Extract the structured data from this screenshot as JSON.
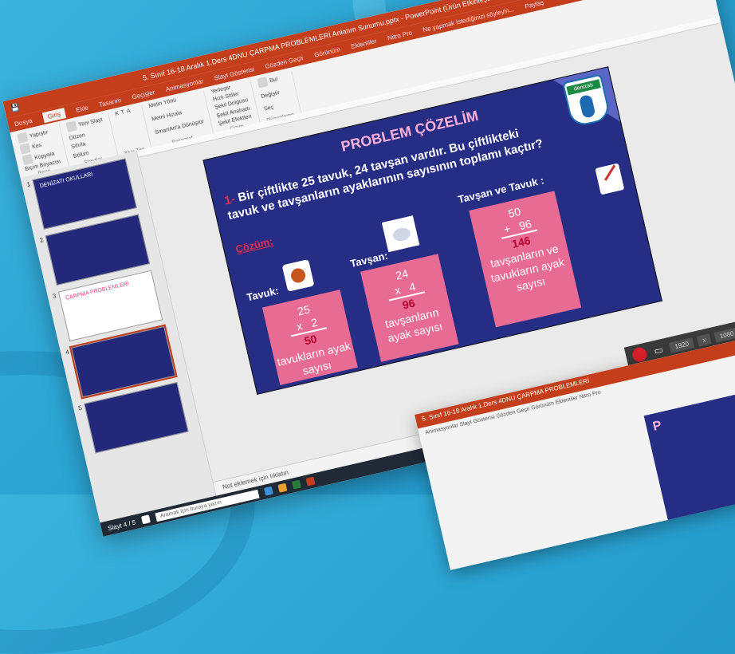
{
  "window": {
    "title": "5. Sınıf 16-18 Aralık 1.Ders 4DNU ÇARPMA PROBLEMLERİ Anlatım Sunumu.pptx - PowerPoint (Ürün Etkinleştirilemedi)",
    "minimize": "—",
    "maximize": "▢",
    "close": "✕",
    "share": "Paylaş"
  },
  "ribbon": {
    "tabs": [
      "Dosya",
      "Giriş",
      "Ekle",
      "Tasarım",
      "Geçişler",
      "Animasyonlar",
      "Slayt Gösterisi",
      "Gözden Geçir",
      "Görünüm",
      "Eklentiler",
      "Nitro Pro"
    ],
    "tell_me": "Ne yapmak istediğinizi söyleyin...",
    "groups": [
      {
        "label": "Pano",
        "items": [
          "Yapıştır",
          "Kes",
          "Kopyala",
          "Biçim Boyacısı"
        ]
      },
      {
        "label": "Slaytlar",
        "items": [
          "Yeni Slayt",
          "Düzen",
          "Sıfırla",
          "Bölüm"
        ]
      },
      {
        "label": "Yazı Tipi",
        "items": [
          "K",
          "T",
          "A"
        ]
      },
      {
        "label": "Paragraf",
        "items": [
          "Metin Yönü",
          "Metni Hizala",
          "SmartArt'a Dönüştür"
        ]
      },
      {
        "label": "Çizim",
        "items": [
          "Yerleştir",
          "Hızlı Stiller",
          "Şekil Dolgusu",
          "Şekil Anahattı",
          "Şekil Efektleri"
        ]
      },
      {
        "label": "Düzenleme",
        "items": [
          "Bul",
          "Değiştir",
          "Seç"
        ]
      }
    ]
  },
  "thumbnails": [
    {
      "num": "1",
      "caption": "DENİZATI OKULLARI"
    },
    {
      "num": "2",
      "caption": ""
    },
    {
      "num": "3",
      "caption": "ÇARPMA PROBLEMLERİ"
    },
    {
      "num": "4",
      "caption": ""
    },
    {
      "num": "5",
      "caption": ""
    }
  ],
  "slide": {
    "logo_text": "denizatı",
    "title": "PROBLEM ÇÖZELİM",
    "question_num": "1-",
    "question": "Bir çiftlikte 25 tavuk, 24 tavşan vardır. Bu çiftlikteki tavuk ve tavşanların ayaklarının sayısının toplamı kaçtır?",
    "solution_label": "Çözüm:",
    "tavuk": {
      "label": "Tavuk:",
      "a": "25",
      "op": "x",
      "b": "2",
      "result": "50",
      "text": "tavukların ayak sayısı"
    },
    "tavsan": {
      "label": "Tavşan:",
      "a": "24",
      "op": "x",
      "b": "4",
      "result": "96",
      "text": "tavşanların ayak sayısı"
    },
    "toplam": {
      "label": "Tavşan ve Tavuk :",
      "a": "50",
      "op": "+",
      "b": "96",
      "result": "146",
      "text": "tavşanların ve tavukların ayak sayısı"
    }
  },
  "notes_placeholder": "Not eklemek için tıklatın",
  "status": {
    "slide_counter": "Slayt 4 / 5"
  },
  "recorder": {
    "resolution_w": "1920",
    "resolution_x": "x",
    "resolution_h": "1080"
  },
  "taskbar": {
    "search_placeholder": "Aramak için buraya yazın"
  },
  "second_window": {
    "title": "5. Sınıf 16-18 Aralık 1.Ders 4DNU ÇARPMA PROBLEMLERİ",
    "tabs": "Animasyonlar   Slayt Gösterisi   Gözden Geçir   Görünüm   Eklentiler   Nitro Pro",
    "slide_title": "P"
  }
}
